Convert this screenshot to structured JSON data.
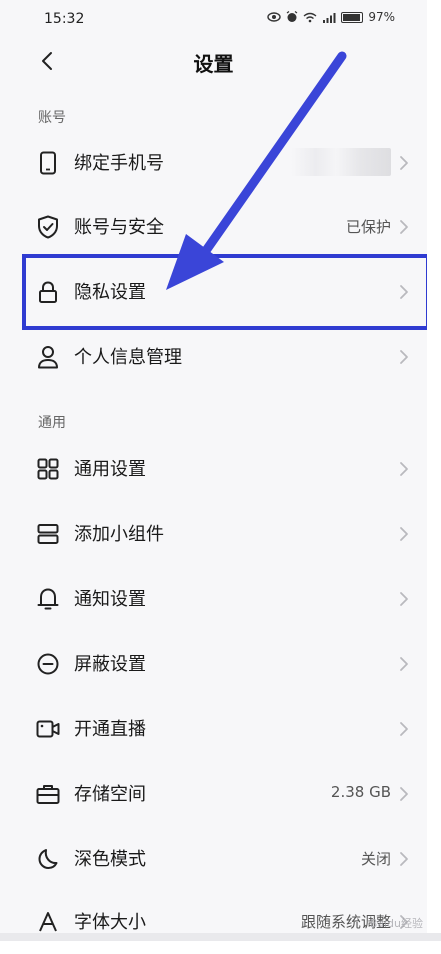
{
  "status_bar": {
    "time": "15:32",
    "battery": "97%",
    "icons": [
      "eye-icon",
      "alarm-icon",
      "wifi-icon",
      "signal-icon",
      "battery-icon"
    ]
  },
  "nav": {
    "title": "设置",
    "back_icon": "chevron-left-icon"
  },
  "sections": {
    "account": {
      "header": "账号",
      "items": [
        {
          "label": "绑定手机号",
          "value": "",
          "icon": "phone-icon"
        },
        {
          "label": "账号与安全",
          "value": "已保护",
          "icon": "shield-check-icon"
        },
        {
          "label": "隐私设置",
          "value": "",
          "icon": "lock-icon"
        },
        {
          "label": "个人信息管理",
          "value": "",
          "icon": "person-icon"
        }
      ]
    },
    "general": {
      "header": "通用",
      "items": [
        {
          "label": "通用设置",
          "value": "",
          "icon": "grid-icon"
        },
        {
          "label": "添加小组件",
          "value": "",
          "icon": "widget-icon"
        },
        {
          "label": "通知设置",
          "value": "",
          "icon": "bell-icon"
        },
        {
          "label": "屏蔽设置",
          "value": "",
          "icon": "block-icon"
        },
        {
          "label": "开通直播",
          "value": "",
          "icon": "video-icon"
        },
        {
          "label": "存储空间",
          "value": "2.38 GB",
          "icon": "storage-icon"
        },
        {
          "label": "深色模式",
          "value": "关闭",
          "icon": "moon-icon"
        },
        {
          "label": "字体大小",
          "value": "跟随系统调整",
          "icon": "font-icon"
        }
      ]
    }
  },
  "annotation": {
    "highlight_color": "#2f3bd1",
    "arrow_color": "#3a45d8"
  },
  "watermark": "Baidu经验"
}
